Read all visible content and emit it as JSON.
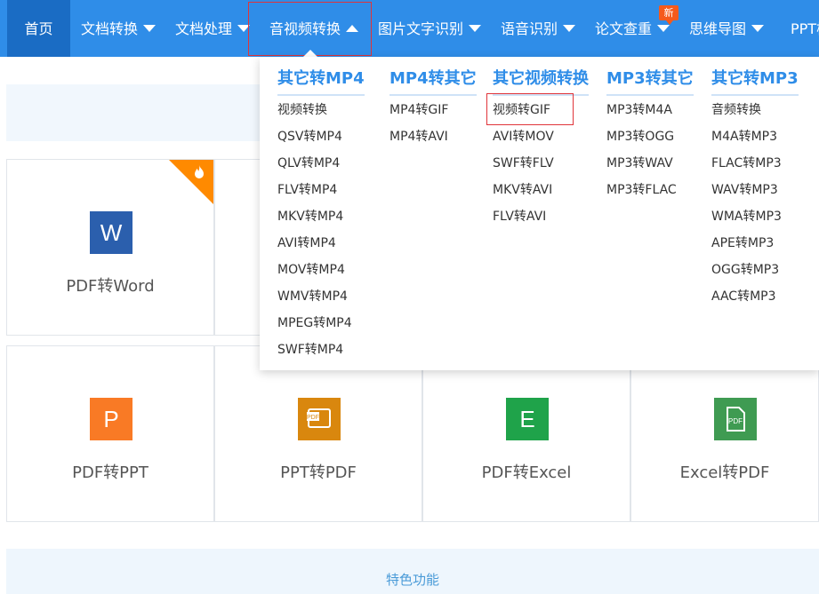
{
  "nav": {
    "home": "首页",
    "items": [
      "文档转换",
      "文档处理",
      "音视频转换",
      "图片文字识别",
      "语音识别",
      "论文查重",
      "思维导图",
      "PPT模"
    ],
    "badge": "新"
  },
  "cards": [
    {
      "label": "PDF转Word",
      "icon_text": "W",
      "color": "#2b5fad",
      "hot": true
    },
    {
      "label": "PDF转PPT",
      "icon_text": "P",
      "color": "#f97a25"
    },
    {
      "label": "PPT转PDF",
      "icon_text": "PDF",
      "color": "#e08a1c"
    },
    {
      "label": "PDF转Excel",
      "icon_text": "E",
      "color": "#1fa34a"
    },
    {
      "label": "Excel转PDF",
      "icon_text": "PDF",
      "color": "#3f9b52"
    }
  ],
  "feature": "特色功能",
  "dropdown": {
    "columns": [
      {
        "title": "其它转MP4",
        "items": [
          "视频转换",
          "QSV转MP4",
          "QLV转MP4",
          "FLV转MP4",
          "MKV转MP4",
          "AVI转MP4",
          "MOV转MP4",
          "WMV转MP4",
          "MPEG转MP4",
          "SWF转MP4"
        ]
      },
      {
        "title": "MP4转其它",
        "items": [
          "MP4转GIF",
          "MP4转AVI"
        ]
      },
      {
        "title": "其它视频转换",
        "items": [
          "视频转GIF",
          "AVI转MOV",
          "SWF转FLV",
          "MKV转AVI",
          "FLV转AVI"
        ]
      },
      {
        "title": "MP3转其它",
        "items": [
          "MP3转M4A",
          "MP3转OGG",
          "MP3转WAV",
          "MP3转FLAC"
        ]
      },
      {
        "title": "其它转MP3",
        "items": [
          "音频转换",
          "M4A转MP3",
          "FLAC转MP3",
          "WAV转MP3",
          "WMA转MP3",
          "APE转MP3",
          "OGG转MP3",
          "AAC转MP3"
        ]
      }
    ]
  }
}
